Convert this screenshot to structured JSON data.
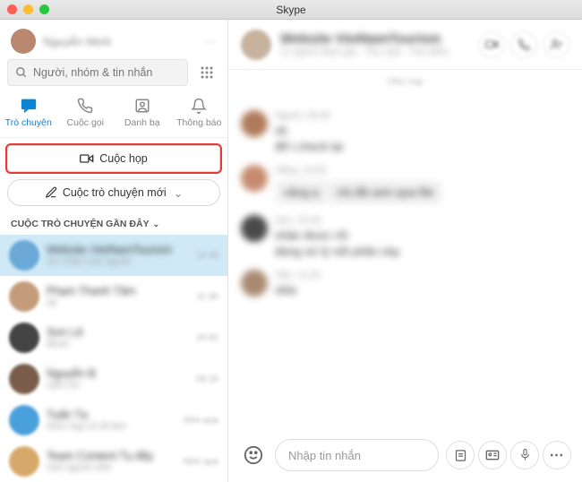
{
  "window": {
    "title": "Skype"
  },
  "profile": {
    "name": "Nguyễn Minh"
  },
  "search": {
    "placeholder": "Người, nhóm & tin nhắn"
  },
  "tabs": [
    {
      "id": "chats",
      "label": "Trò chuyện",
      "active": true
    },
    {
      "id": "calls",
      "label": "Cuộc gọi",
      "active": false
    },
    {
      "id": "contacts",
      "label": "Danh bạ",
      "active": false
    },
    {
      "id": "notifications",
      "label": "Thông báo",
      "active": false
    }
  ],
  "buttons": {
    "meet_now": "Cuộc họp",
    "new_chat": "Cuộc trò chuyện mới"
  },
  "recent_header": "CUỘC TRÒ CHUYỆN GẦN ĐÂY",
  "conversations": [
    {
      "name": "Website VietNamTourism",
      "preview": "xin chào mọi người",
      "time": "12:45",
      "selected": true,
      "color": "#6aa8d8"
    },
    {
      "name": "Phạm Thanh Tâm",
      "preview": "ok",
      "time": "11:30",
      "selected": false,
      "color": "#c29c7b"
    },
    {
      "name": "Sơn Lê",
      "preview": "được",
      "time": "10:02",
      "selected": false,
      "color": "#444"
    },
    {
      "name": "Nguyễn B",
      "preview": "cảm ơn",
      "time": "09:15",
      "selected": false,
      "color": "#7a5c4a"
    },
    {
      "name": "Tuấn Tạ",
      "preview": "hôm nay có đi làm",
      "time": "hôm qua",
      "selected": false,
      "color": "#4aa0da"
    },
    {
      "name": "Team Content Tụ đây",
      "preview": "mọi người nhớ",
      "time": "hôm qua",
      "selected": false,
      "color": "#d6a96b"
    }
  ],
  "chat": {
    "title": "Website VietNamTourism",
    "subtitle": "11 người tham gia · Thư viện · Tìm kiếm",
    "messages": [
      {
        "avatar": "#b07a5c",
        "meta": "Người, 09:30",
        "lines": [
          "ok",
          "để t check lại"
        ]
      },
      {
        "avatar": "#c68b6e",
        "meta": "Hằng, 10:05",
        "lines": [
          "vâng ạ",
          "chị đã xem qua file"
        ],
        "bubble": true
      },
      {
        "avatar": "#4a4a4a",
        "meta": "Sơn, 10:40",
        "lines": [
          "nhận được rồi",
          "đang xử lý nốt phần này"
        ]
      },
      {
        "avatar": "#a88a72",
        "meta": "Hân, 11:20",
        "lines": [
          "okla"
        ]
      }
    ]
  },
  "composer": {
    "placeholder": "Nhập tin nhắn"
  }
}
